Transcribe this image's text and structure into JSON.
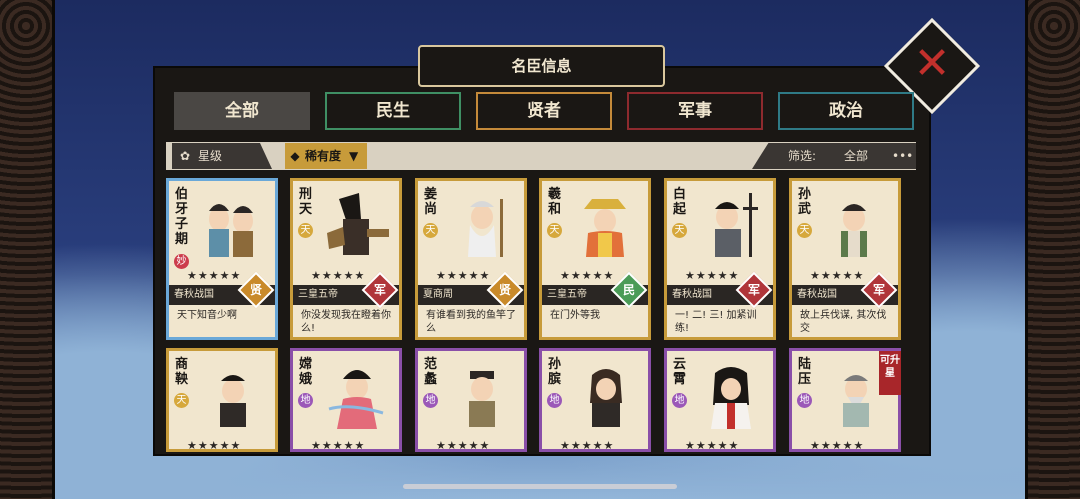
{
  "title": "名臣信息",
  "close": "✕",
  "tabs": [
    {
      "label": "全部",
      "color": "#4a4744"
    },
    {
      "label": "民生",
      "color": "#3f8f64"
    },
    {
      "label": "贤者",
      "color": "#c48a3a"
    },
    {
      "label": "军事",
      "color": "#8e2a2e"
    },
    {
      "label": "政治",
      "color": "#2f7a86"
    }
  ],
  "filters": {
    "star": "星级",
    "rarity": "稀有度",
    "screen_label": "筛选:",
    "screen_value": "全部",
    "more": "•••"
  },
  "cards": [
    {
      "name": "伯牙子期",
      "grade": "妙",
      "grade_type": "miao",
      "stars": "★★★★★",
      "era": "春秋战国",
      "badge": "贤",
      "badge_type": "xian",
      "quote": "天下知音少啊",
      "border": "blue"
    },
    {
      "name": "刑天",
      "grade": "天",
      "grade_type": "tian",
      "stars": "★★★★★",
      "era": "三皇五帝",
      "badge": "军",
      "badge_type": "jun",
      "quote": "你没发现我在瞪着你么!",
      "border": "gold"
    },
    {
      "name": "姜尚",
      "grade": "天",
      "grade_type": "tian",
      "stars": "★★★★★",
      "era": "夏商周",
      "badge": "贤",
      "badge_type": "xian",
      "quote": "有谁看到我的鱼竿了么",
      "border": "gold"
    },
    {
      "name": "羲和",
      "grade": "天",
      "grade_type": "tian",
      "stars": "★★★★★",
      "era": "三皇五帝",
      "badge": "民",
      "badge_type": "min",
      "quote": "在门外等我",
      "border": "gold"
    },
    {
      "name": "白起",
      "grade": "天",
      "grade_type": "tian",
      "stars": "★★★★★",
      "era": "春秋战国",
      "badge": "军",
      "badge_type": "jun",
      "quote": "一! 二! 三! 加紧训练!",
      "border": "gold"
    },
    {
      "name": "孙武",
      "grade": "天",
      "grade_type": "tian",
      "stars": "★★★★★",
      "era": "春秋战国",
      "badge": "军",
      "badge_type": "jun",
      "quote": "故上兵伐谋, 其次伐交",
      "border": "gold"
    },
    {
      "name": "商鞅",
      "grade": "天",
      "grade_type": "tian",
      "stars": "★★★★★",
      "border": "gold"
    },
    {
      "name": "嫦娥",
      "grade": "地",
      "grade_type": "di",
      "stars": "★★★★★",
      "border": "purple"
    },
    {
      "name": "范蠡",
      "grade": "地",
      "grade_type": "di",
      "stars": "★★★★★",
      "border": "purple"
    },
    {
      "name": "孙膑",
      "grade": "地",
      "grade_type": "di",
      "stars": "★★★★★",
      "border": "purple"
    },
    {
      "name": "云霄",
      "grade": "地",
      "grade_type": "di",
      "stars": "★★★★★",
      "border": "purple"
    },
    {
      "name": "陆压",
      "grade": "地",
      "grade_type": "di",
      "stars": "★★★★★",
      "border": "purple"
    }
  ],
  "upgrade_tag": "可升星"
}
